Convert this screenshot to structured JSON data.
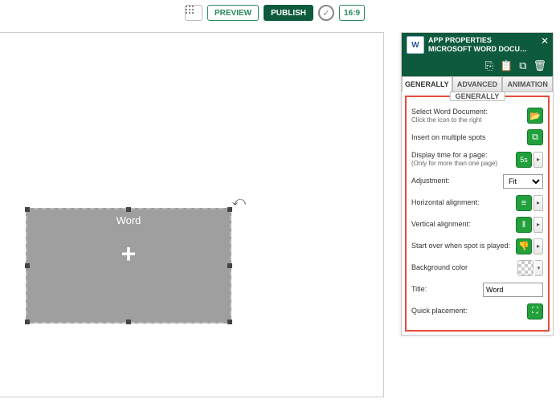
{
  "toolbar": {
    "preview": "PREVIEW",
    "publish": "PUBLISH",
    "ratio": "16:9"
  },
  "canvas": {
    "spot_label": "Word",
    "spot_plus": "+"
  },
  "panel": {
    "header": {
      "line1": "APP PROPERTIES",
      "line2": "MICROSOFT WORD DOCU…"
    },
    "tabs": {
      "generally": "GENERALLY",
      "advanced": "ADVANCED",
      "animation": "ANIMATION"
    },
    "section_title": "GENERALLY",
    "rows": {
      "select_doc": {
        "label": "Select Word Document:",
        "sub": "Click the icon to the right"
      },
      "multi": {
        "label": "Insert on multiple spots"
      },
      "display_time": {
        "label": "Display time for a page:",
        "sub": "(Only for more than one page)",
        "icon_text": "5s"
      },
      "adjustment": {
        "label": "Adjustment:",
        "value": "Fit"
      },
      "halign": {
        "label": "Horizontal alignment:"
      },
      "valign": {
        "label": "Vertical alignment:"
      },
      "start_over": {
        "label": "Start over when spot is played:"
      },
      "bg": {
        "label": "Background color"
      },
      "title": {
        "label": "Title:",
        "value": "Word"
      },
      "quick": {
        "label": "Quick placement:"
      }
    }
  }
}
